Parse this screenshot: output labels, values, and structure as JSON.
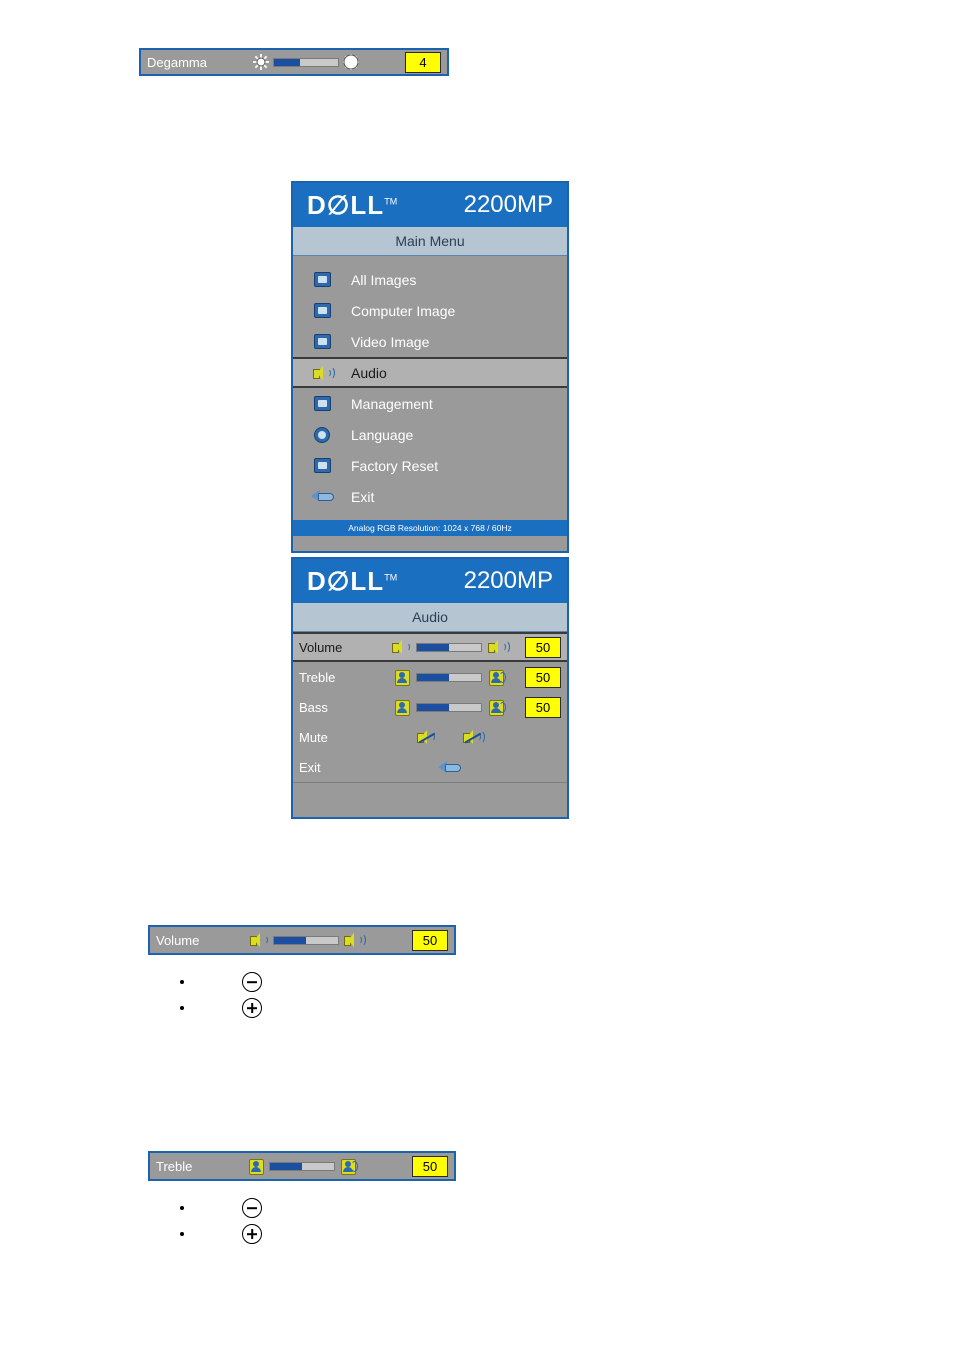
{
  "degamma_bar": {
    "label": "Degamma",
    "value": "4",
    "slider_percent": 40,
    "icon_left": "sun-small-icon",
    "icon_right": "sun-large-icon"
  },
  "main_menu_panel": {
    "brand": "D",
    "brand_full": "DELL",
    "trademark": "TM",
    "model": "2200MP",
    "title": "Main Menu",
    "footer": "Analog RGB Resolution: 1024 x 768 / 60Hz",
    "items": [
      {
        "label": "All Images",
        "icon": "all-images-icon",
        "selected": false
      },
      {
        "label": "Computer Image",
        "icon": "computer-image-icon",
        "selected": false
      },
      {
        "label": "Video Image",
        "icon": "video-image-icon",
        "selected": false
      },
      {
        "label": "Audio",
        "icon": "audio-speaker-icon",
        "selected": true
      },
      {
        "label": "Management",
        "icon": "management-icon",
        "selected": false
      },
      {
        "label": "Language",
        "icon": "language-globe-icon",
        "selected": false
      },
      {
        "label": "Factory Reset",
        "icon": "factory-reset-icon",
        "selected": false
      },
      {
        "label": "Exit",
        "icon": "exit-arrow-icon",
        "selected": false
      }
    ]
  },
  "audio_panel": {
    "brand_full": "DELL",
    "trademark": "TM",
    "model": "2200MP",
    "title": "Audio",
    "rows": [
      {
        "label": "Volume",
        "value": "50",
        "slider_percent": 50,
        "selected": true,
        "icon_left": "speaker-low-icon",
        "icon_right": "speaker-high-icon",
        "has_slider": true
      },
      {
        "label": "Treble",
        "value": "50",
        "slider_percent": 50,
        "selected": false,
        "icon_left": "treble-low-icon",
        "icon_right": "treble-high-icon",
        "has_slider": true
      },
      {
        "label": "Bass",
        "value": "50",
        "slider_percent": 50,
        "selected": false,
        "icon_left": "bass-low-icon",
        "icon_right": "bass-high-icon",
        "has_slider": true
      },
      {
        "label": "Mute",
        "value": "",
        "selected": false,
        "icon_left": "mute-off-icon",
        "icon_right": "mute-on-icon",
        "has_slider": false
      },
      {
        "label": "Exit",
        "value": "",
        "selected": false,
        "icon_center": "exit-arrow-icon",
        "has_slider": false
      }
    ]
  },
  "volume_bar": {
    "label": "Volume",
    "value": "50",
    "slider_percent": 50,
    "icon_left": "speaker-low-icon",
    "icon_right": "speaker-high-icon"
  },
  "volume_bullets": [
    {
      "icon": "minus-circle-icon"
    },
    {
      "icon": "plus-circle-icon"
    }
  ],
  "treble_bar": {
    "label": "Treble",
    "value": "50",
    "slider_percent": 50,
    "icon_left": "treble-low-icon",
    "icon_right": "treble-high-icon"
  },
  "treble_bullets": [
    {
      "icon": "minus-circle-icon"
    },
    {
      "icon": "plus-circle-icon"
    }
  ],
  "colors": {
    "osd_blue": "#1b6fc0",
    "osd_gray": "#9a9a9a",
    "value_yellow": "#ffff00",
    "slider_fill": "#1b4fa0",
    "title_band": "#b6c5d2"
  }
}
